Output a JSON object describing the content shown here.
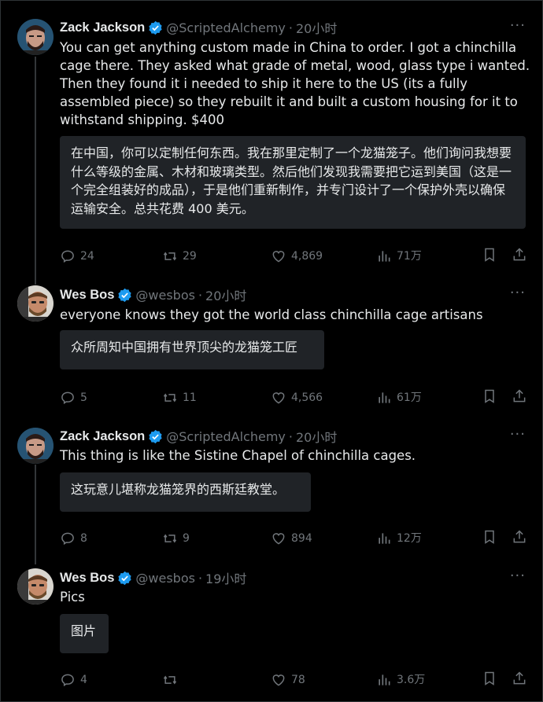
{
  "colors": {
    "background": "#000000",
    "text": "#e7e9ea",
    "muted": "#71767b",
    "verified": "#1d9bf0",
    "translation_bg": "#202327"
  },
  "tweets": [
    {
      "name": "Zack Jackson",
      "handle": "@ScriptedAlchemy",
      "time": "20小时",
      "text": "You can get anything custom made in China to order. I got a chinchilla cage there. They asked what grade of metal, wood, glass type i wanted. Then they found it i needed to ship it here to the US (its a fully assembled piece) so they rebuilt it and built a custom housing for it to withstand shipping. $400",
      "translation": "在中国，你可以定制任何东西。我在那里定制了一个龙猫笼子。他们询问我想要什么等级的金属、木材和玻璃类型。然后他们发现我需要把它运到美国（这是一个完全组装好的成品），于是他们重新制作，并专门设计了一个保护外壳以确保运输安全。总共花费 400 美元。",
      "replies": "24",
      "retweets": "29",
      "likes": "4,869",
      "views": "71万"
    },
    {
      "name": "Wes Bos",
      "handle": "@wesbos",
      "time": "20小时",
      "text": "everyone knows they got the world class chinchilla cage artisans",
      "translation": "众所周知中国拥有世界顶尖的龙猫笼工匠",
      "replies": "5",
      "retweets": "11",
      "likes": "4,566",
      "views": "61万"
    },
    {
      "name": "Zack Jackson",
      "handle": "@ScriptedAlchemy",
      "time": "20小时",
      "text": "This thing is like the Sistine Chapel of chinchilla cages.",
      "translation": "这玩意儿堪称龙猫笼界的西斯廷教堂。",
      "replies": "8",
      "retweets": "9",
      "likes": "894",
      "views": "12万"
    },
    {
      "name": "Wes Bos",
      "handle": "@wesbos",
      "time": "19小时",
      "text": "Pics",
      "translation": "图片",
      "replies": "4",
      "retweets": "",
      "likes": "78",
      "views": "3.6万"
    }
  ],
  "icons": {
    "reply": "reply-icon",
    "retweet": "retweet-icon",
    "like": "heart-icon",
    "views": "views-icon",
    "bookmark": "bookmark-icon",
    "share": "share-icon",
    "more": "more-icon",
    "verified": "verified-badge-icon"
  },
  "more_label": "···"
}
